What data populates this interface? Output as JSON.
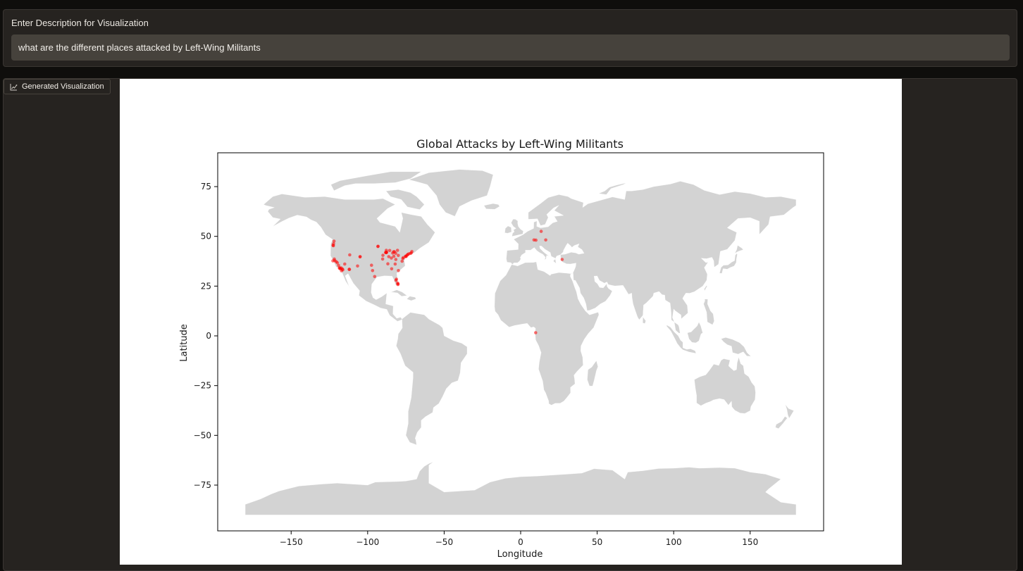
{
  "input": {
    "label": "Enter Description for Visualization",
    "value": "what are the different places attacked by Left-Wing Militants"
  },
  "output": {
    "tab_label": "Generated Visualization",
    "tab_icon": "chart-icon"
  },
  "chart_data": {
    "type": "scatter",
    "title": "Global Attacks by Left-Wing Militants",
    "xlabel": "Longitude",
    "ylabel": "Latitude",
    "xlim": [
      -198,
      198
    ],
    "ylim": [
      -98,
      92
    ],
    "xticks": [
      -150,
      -100,
      -50,
      0,
      50,
      100,
      150
    ],
    "yticks": [
      -75,
      -50,
      -25,
      0,
      25,
      50,
      75
    ],
    "grid": false,
    "basemap": "world countries",
    "colors": {
      "land": "#d3d3d3",
      "points": "#ff0000"
    },
    "series": [
      {
        "x": [
          -122.6,
          -122.4,
          -122.3,
          -122.0,
          -121.8,
          -121.5,
          -120.5,
          -119.8,
          -118.5,
          -118.2,
          -117.9,
          -117.3,
          -117.1,
          -116.5,
          -115.0,
          -112.1,
          -111.7,
          -111.9,
          -105.0,
          -104.9,
          -95.4,
          -93.3,
          -93.2,
          -90.2,
          -90.0,
          -88.0,
          -87.7,
          -87.6,
          -86.2,
          -84.5,
          -83.6,
          -83.0,
          -81.7,
          -81.2,
          -80.2,
          -80.4,
          -80.1,
          -80.0,
          -79.9,
          -77.5,
          -77.0,
          -76.7,
          -75.2,
          -75.1,
          -74.8,
          -74.0,
          -73.9,
          -73.2,
          -72.1,
          -71.5,
          -71.1,
          -82.0,
          -85.6,
          -80.5,
          -82.5,
          -81.5,
          -96.8,
          -97.5,
          -87.8,
          -82.9,
          -84.3,
          -86.8,
          -106.6,
          -116.2,
          -119.0,
          -88.3,
          -81.6,
          -122.7,
          10.0,
          13.4,
          8.7,
          16.4,
          27.1,
          9.8
        ],
        "y": [
          45.5,
          45.3,
          46.3,
          47.6,
          38.6,
          37.8,
          37.3,
          36.7,
          34.0,
          34.1,
          33.7,
          34.1,
          32.7,
          33.6,
          36.1,
          33.4,
          40.7,
          33.4,
          39.7,
          39.8,
          29.8,
          44.9,
          45.0,
          38.6,
          40.5,
          41.8,
          41.9,
          42.0,
          39.8,
          39.1,
          41.6,
          42.3,
          41.5,
          28.5,
          25.8,
          26.5,
          26.1,
          40.4,
          32.8,
          37.5,
          38.9,
          39.3,
          39.9,
          40.1,
          39.9,
          40.7,
          40.8,
          41.2,
          41.4,
          41.7,
          42.4,
          36.1,
          42.9,
          43.0,
          42.3,
          27.9,
          32.8,
          35.5,
          43.0,
          40.0,
          33.7,
          36.2,
          35.1,
          33.2,
          35.4,
          41.9,
          38.4,
          37.7,
          48.1,
          52.5,
          48.2,
          48.2,
          38.4,
          1.6
        ]
      }
    ]
  }
}
